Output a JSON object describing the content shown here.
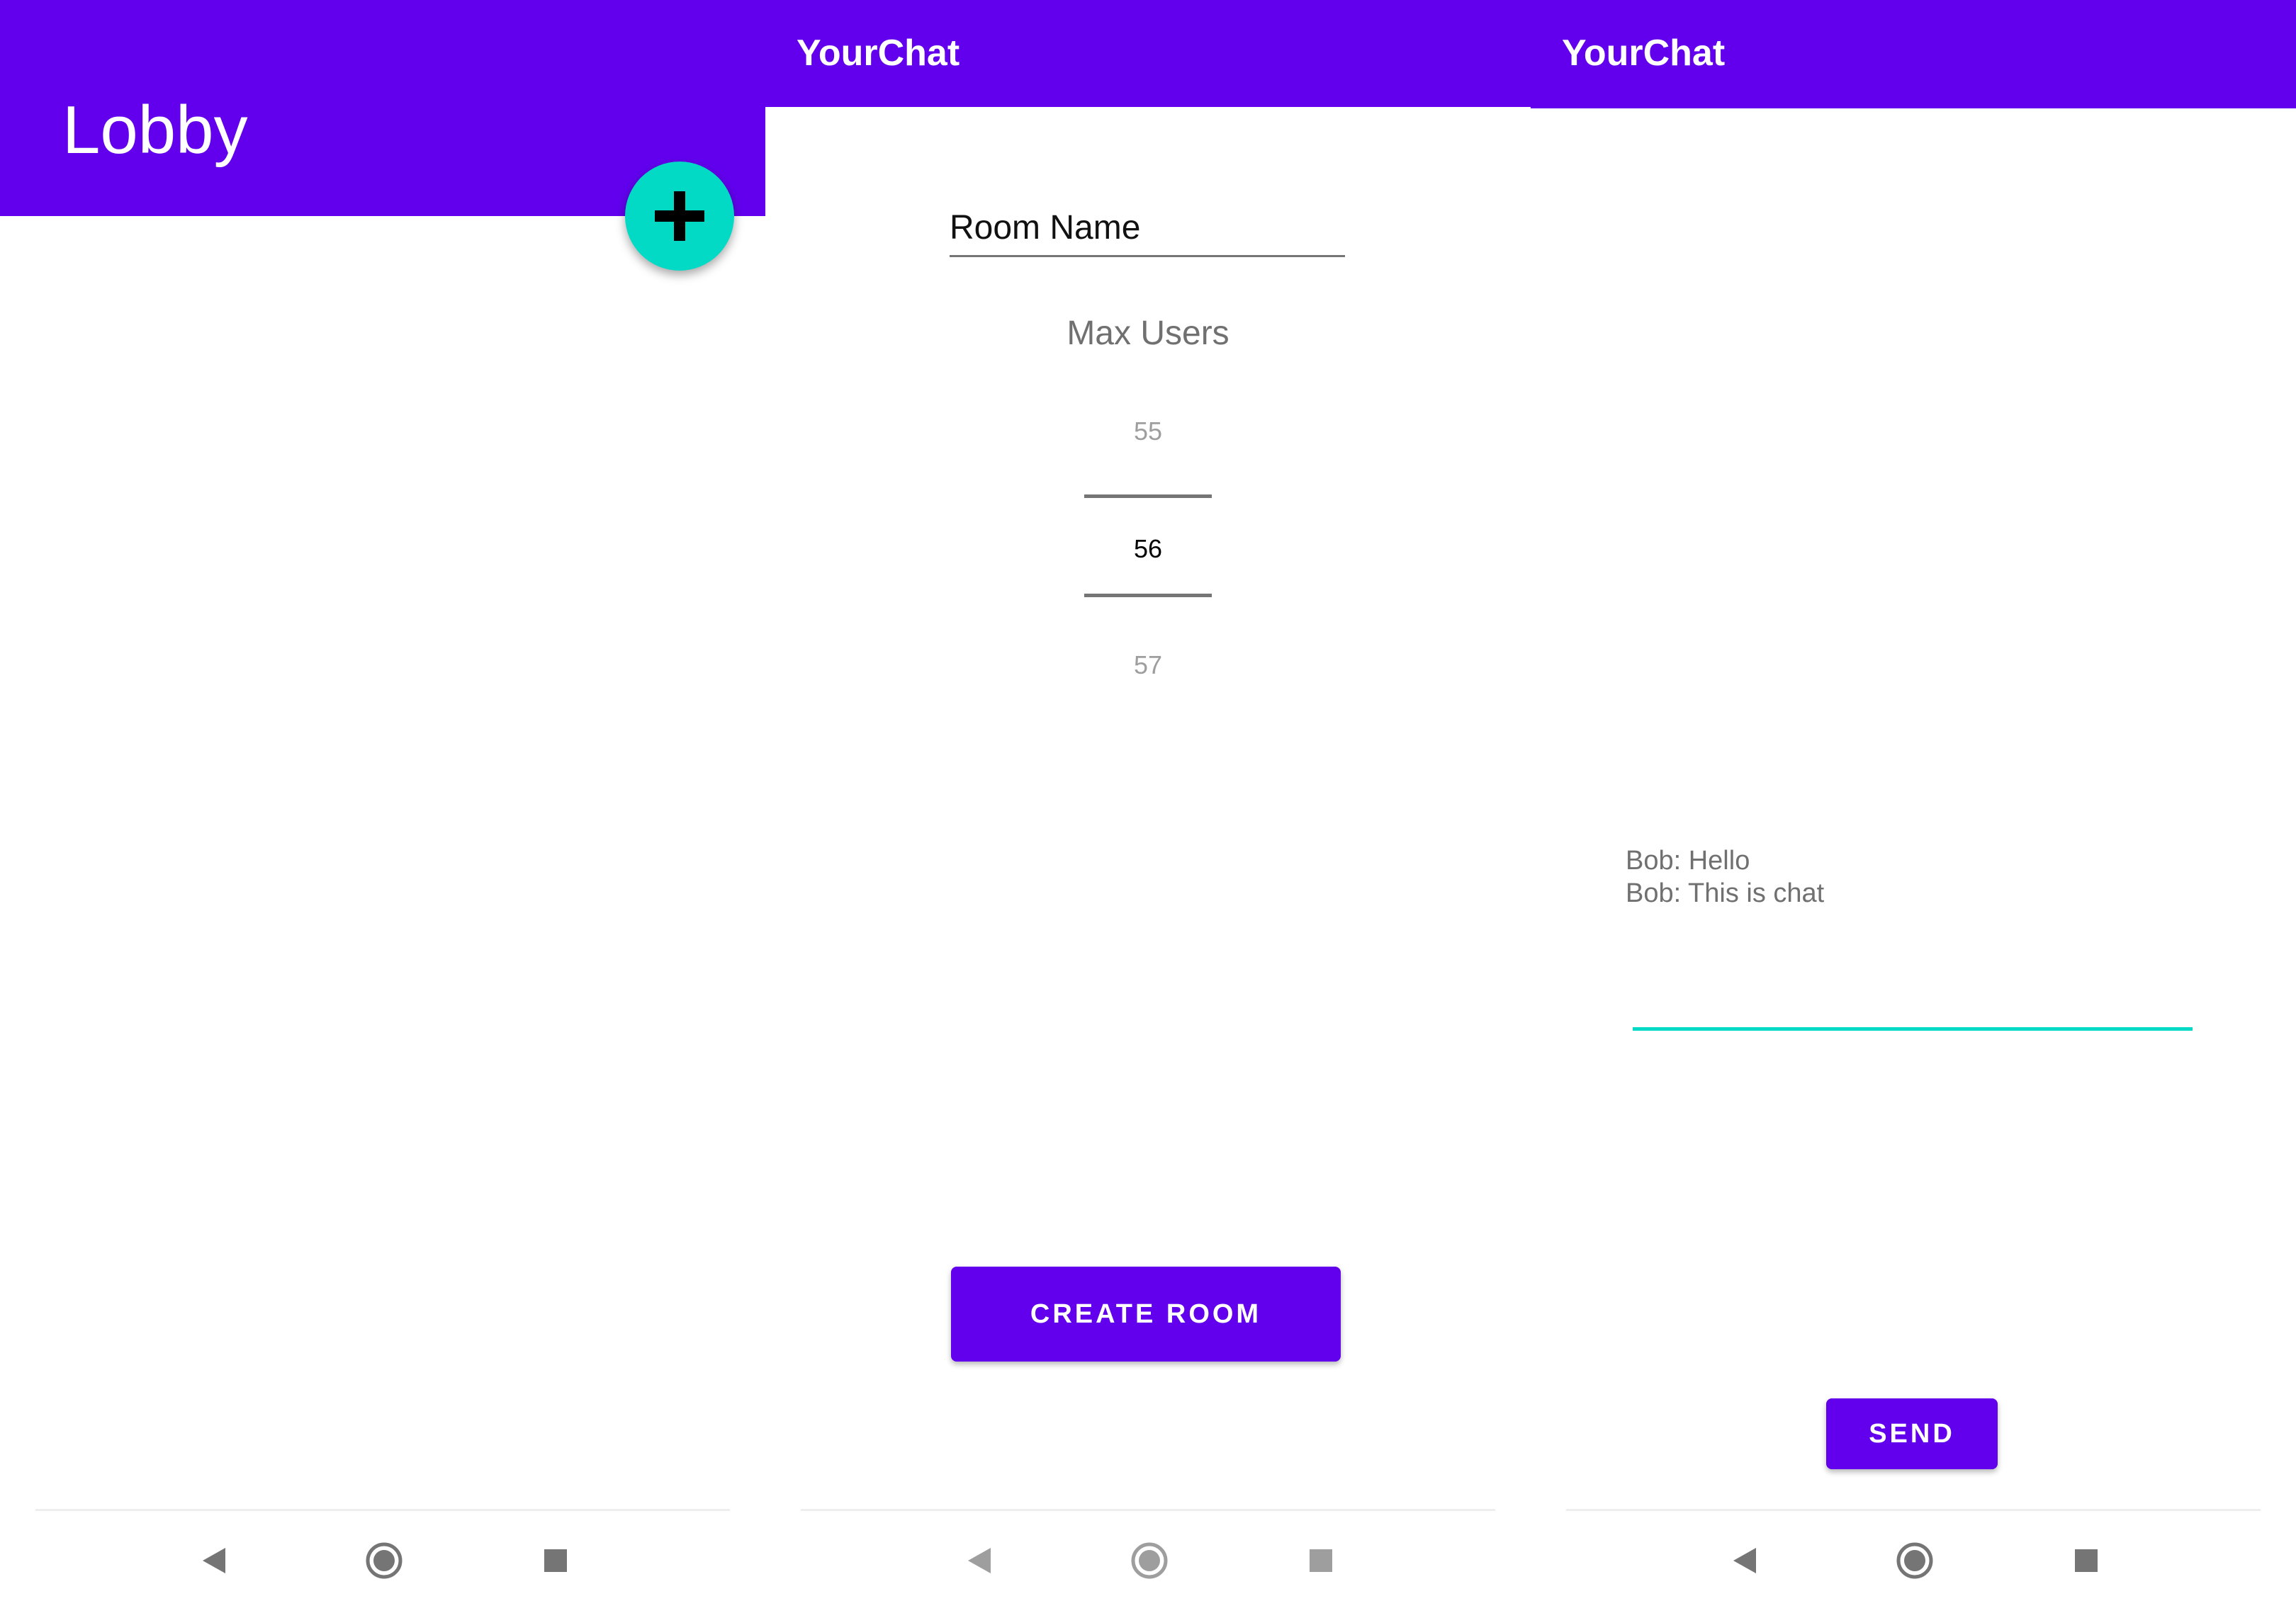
{
  "screens": [
    {
      "title": "Lobby",
      "fab": {
        "icon": "add-icon"
      }
    },
    {
      "title": "YourChat",
      "room_name": {
        "placeholder": "Room Name",
        "value": ""
      },
      "max_users": {
        "label": "Max Users",
        "prev": "55",
        "selected": "56",
        "next": "57"
      },
      "create_label": "CREATE ROOM"
    },
    {
      "title": "YourChat",
      "messages": [
        "Bob: Hello",
        "Bob: This is chat"
      ],
      "send_label": "SEND"
    }
  ],
  "navbar": {
    "icons": [
      "back-icon",
      "home-icon",
      "recent-apps-icon"
    ]
  },
  "colors": {
    "primary": "#6200ee",
    "accent": "#03dac5"
  }
}
